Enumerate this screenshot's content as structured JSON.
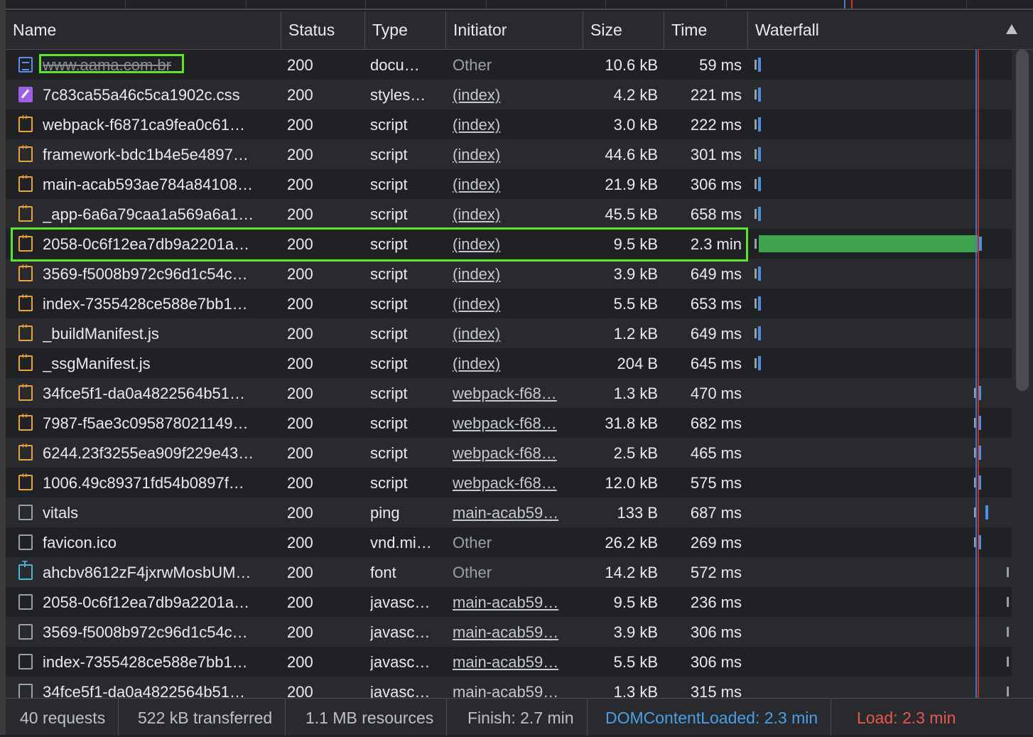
{
  "columns": {
    "name": "Name",
    "status": "Status",
    "type": "Type",
    "initiator": "Initiator",
    "size": "Size",
    "time": "Time",
    "waterfall": "Waterfall"
  },
  "rows": [
    {
      "icon": "doc",
      "name": "www.aama.com.br",
      "status": "200",
      "type": "docu…",
      "initiator": "Other",
      "size": "10.6 kB",
      "time": "59 ms"
    },
    {
      "icon": "css",
      "name": "7c83ca55a46c5ca1902c.css",
      "status": "200",
      "type": "styles…",
      "initiator": "(index)",
      "size": "4.2 kB",
      "time": "221 ms"
    },
    {
      "icon": "js",
      "name": "webpack-f6871ca9fea0c61…",
      "status": "200",
      "type": "script",
      "initiator": "(index)",
      "size": "3.0 kB",
      "time": "222 ms"
    },
    {
      "icon": "js",
      "name": "framework-bdc1b4e5e4897…",
      "status": "200",
      "type": "script",
      "initiator": "(index)",
      "size": "44.6 kB",
      "time": "301 ms"
    },
    {
      "icon": "js",
      "name": "main-acab593ae784a84108…",
      "status": "200",
      "type": "script",
      "initiator": "(index)",
      "size": "21.9 kB",
      "time": "306 ms"
    },
    {
      "icon": "js",
      "name": "_app-6a6a79caa1a569a6a1…",
      "status": "200",
      "type": "script",
      "initiator": "(index)",
      "size": "45.5 kB",
      "time": "658 ms"
    },
    {
      "icon": "js",
      "name": "2058-0c6f12ea7db9a2201a…",
      "status": "200",
      "type": "script",
      "initiator": "(index)",
      "size": "9.5 kB",
      "time": "2.3 min"
    },
    {
      "icon": "js",
      "name": "3569-f5008b972c96d1c54c…",
      "status": "200",
      "type": "script",
      "initiator": "(index)",
      "size": "3.9 kB",
      "time": "649 ms"
    },
    {
      "icon": "js",
      "name": "index-7355428ce588e7bb1…",
      "status": "200",
      "type": "script",
      "initiator": "(index)",
      "size": "5.5 kB",
      "time": "653 ms"
    },
    {
      "icon": "js",
      "name": "_buildManifest.js",
      "status": "200",
      "type": "script",
      "initiator": "(index)",
      "size": "1.2 kB",
      "time": "649 ms"
    },
    {
      "icon": "js",
      "name": "_ssgManifest.js",
      "status": "200",
      "type": "script",
      "initiator": "(index)",
      "size": "204 B",
      "time": "645 ms"
    },
    {
      "icon": "js",
      "name": "34fce5f1-da0a4822564b51…",
      "status": "200",
      "type": "script",
      "initiator": "webpack-f68…",
      "size": "1.3 kB",
      "time": "470 ms"
    },
    {
      "icon": "js",
      "name": "7987-f5ae3c095878021149…",
      "status": "200",
      "type": "script",
      "initiator": "webpack-f68…",
      "size": "31.8 kB",
      "time": "682 ms"
    },
    {
      "icon": "js",
      "name": "6244.23f3255ea909f229e43…",
      "status": "200",
      "type": "script",
      "initiator": "webpack-f68…",
      "size": "2.5 kB",
      "time": "465 ms"
    },
    {
      "icon": "js",
      "name": "1006.49c89371fd54b0897f…",
      "status": "200",
      "type": "script",
      "initiator": "webpack-f68…",
      "size": "12.0 kB",
      "time": "575 ms"
    },
    {
      "icon": "blank",
      "name": "vitals",
      "status": "200",
      "type": "ping",
      "initiator": "main-acab59…",
      "size": "133 B",
      "time": "687 ms"
    },
    {
      "icon": "blank",
      "name": "favicon.ico",
      "status": "200",
      "type": "vnd.mi…",
      "initiator": "Other",
      "size": "26.2 kB",
      "time": "269 ms"
    },
    {
      "icon": "font",
      "name": "ahcbv8612zF4jxrwMosbUM…",
      "status": "200",
      "type": "font",
      "initiator": "Other",
      "size": "14.2 kB",
      "time": "572 ms"
    },
    {
      "icon": "blank",
      "name": "2058-0c6f12ea7db9a2201a…",
      "status": "200",
      "type": "javasc…",
      "initiator": "main-acab59…",
      "size": "9.5 kB",
      "time": "236 ms"
    },
    {
      "icon": "blank",
      "name": "3569-f5008b972c96d1c54c…",
      "status": "200",
      "type": "javasc…",
      "initiator": "main-acab59…",
      "size": "3.9 kB",
      "time": "306 ms"
    },
    {
      "icon": "blank",
      "name": "index-7355428ce588e7bb1…",
      "status": "200",
      "type": "javasc…",
      "initiator": "main-acab59…",
      "size": "5.5 kB",
      "time": "306 ms"
    },
    {
      "icon": "blank",
      "name": "34fce5f1-da0a4822564b51…",
      "status": "200",
      "type": "javasc…",
      "initiator": "main-acab59…",
      "size": "1.3 kB",
      "time": "315 ms"
    }
  ],
  "status_bar": {
    "requests": "40 requests",
    "transferred": "522 kB transferred",
    "resources": "1.1 MB resources",
    "finish": "Finish: 2.7 min",
    "dcl": "DOMContentLoaded: 2.3 min",
    "load": "Load: 2.3 min"
  },
  "colors": {
    "dcl": "#4a9fe8",
    "load": "#e8584e",
    "highlight": "#5ce52c",
    "long_bar": "#3fa34d"
  }
}
